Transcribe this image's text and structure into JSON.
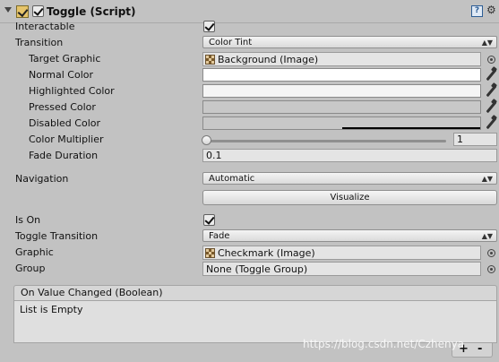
{
  "header": {
    "title": "Toggle (Script)",
    "enabled": true
  },
  "fields": {
    "interactable": {
      "label": "Interactable",
      "checked": true
    },
    "transition": {
      "label": "Transition",
      "value": "Color Tint"
    },
    "target_graphic": {
      "label": "Target Graphic",
      "value": "Background (Image)"
    },
    "normal_color": {
      "label": "Normal Color",
      "color": "#ffffff"
    },
    "highlighted_color": {
      "label": "Highlighted Color",
      "color": "#f5f5f5"
    },
    "pressed_color": {
      "label": "Pressed Color",
      "color": "#c8c8c8"
    },
    "disabled_color": {
      "label": "Disabled Color",
      "color": "#c8c8c8",
      "alpha": 0.5
    },
    "color_multiplier": {
      "label": "Color Multiplier",
      "value": "1",
      "slider_fraction": 0
    },
    "fade_duration": {
      "label": "Fade Duration",
      "value": "0.1"
    },
    "navigation": {
      "label": "Navigation",
      "value": "Automatic"
    },
    "visualize_button": {
      "label": "Visualize"
    },
    "is_on": {
      "label": "Is On",
      "checked": true
    },
    "toggle_transition": {
      "label": "Toggle Transition",
      "value": "Fade"
    },
    "graphic": {
      "label": "Graphic",
      "value": "Checkmark (Image)"
    },
    "group": {
      "label": "Group",
      "value": "None (Toggle Group)"
    }
  },
  "event": {
    "header": "On Value Changed (Boolean)",
    "body": "List is Empty",
    "plus": "+",
    "minus": "-"
  },
  "watermark": "https://blog.csdn.net/Czhenya",
  "colors": {
    "background": "#c2c2c2",
    "field": "#e4e4e4",
    "accent": "#2d5d94"
  }
}
